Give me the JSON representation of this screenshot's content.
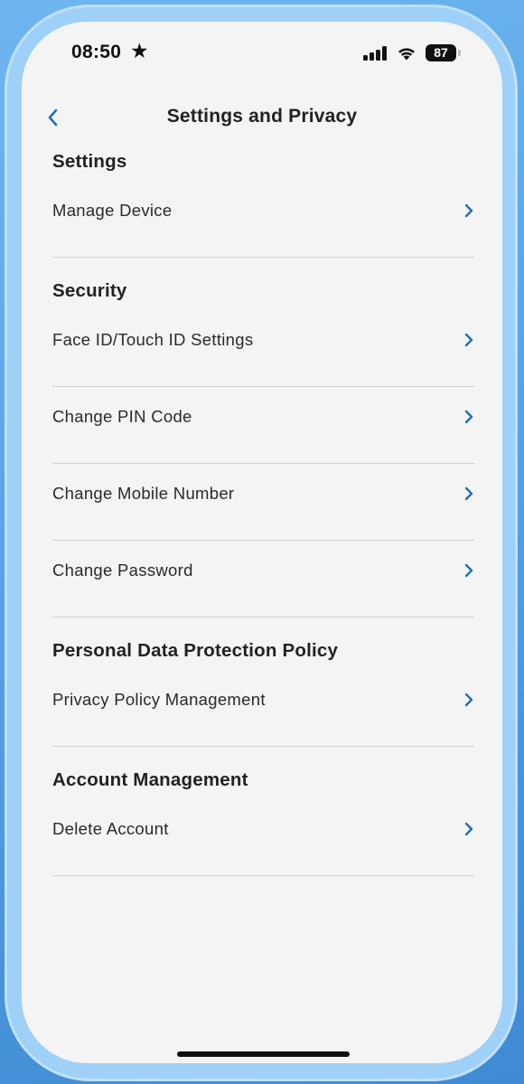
{
  "status_bar": {
    "time": "08:50",
    "star": "★",
    "battery": "87"
  },
  "header": {
    "title": "Settings and Privacy"
  },
  "sections": [
    {
      "title": "Settings",
      "items": [
        {
          "label": "Manage Device"
        }
      ]
    },
    {
      "title": "Security",
      "items": [
        {
          "label": "Face ID/Touch ID Settings"
        },
        {
          "label": "Change PIN Code"
        },
        {
          "label": "Change Mobile Number"
        },
        {
          "label": "Change Password"
        }
      ]
    },
    {
      "title": "Personal Data Protection Policy",
      "items": [
        {
          "label": "Privacy Policy Management"
        }
      ]
    },
    {
      "title": "Account Management",
      "items": [
        {
          "label": "Delete Account"
        }
      ]
    }
  ],
  "colors": {
    "accent": "#1f6fb5",
    "background": "#f4f4f4",
    "divider": "#cfcfcf"
  }
}
